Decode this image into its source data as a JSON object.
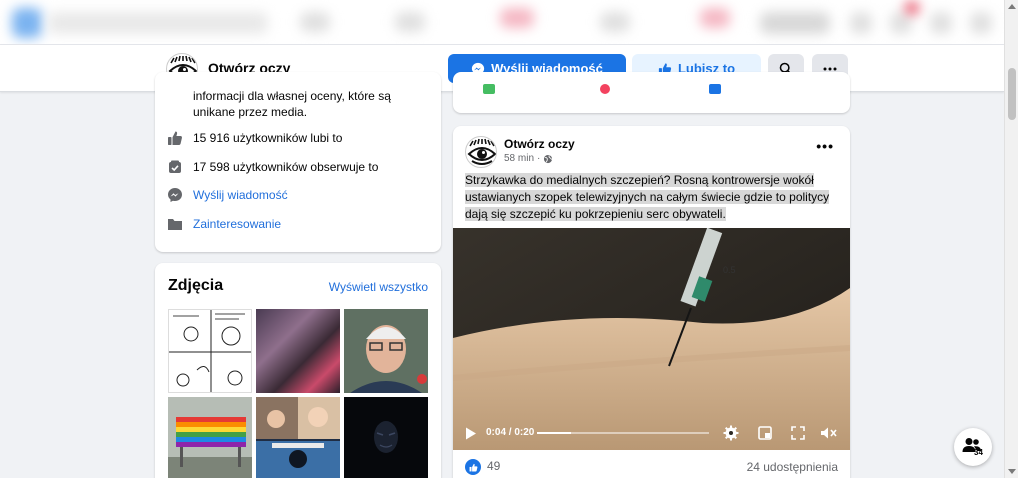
{
  "page_header": {
    "name": "Otwórz oczy",
    "message_button": "Wyślij wiadomość",
    "like_button": "Lubisz to"
  },
  "intro": {
    "text_line1": "informacji dla własnej oceny, które są",
    "text_line2": "unikane przez media.",
    "likes": "15 916 użytkowników lubi to",
    "followers": "17 598 użytkowników obserwuje to",
    "message_link": "Wyślij wiadomość",
    "category": "Zainteresowanie"
  },
  "photos": {
    "title": "Zdjęcia",
    "see_all": "Wyświetl wszystko"
  },
  "post": {
    "author": "Otwórz oczy",
    "time": "58 min",
    "text": "Strzykawka do medialnych szczepień? Rosną kontrowersje wokół ustawianych szopek telewizyjnych na całym świecie gdzie to politycy dają się szczepić ku pokrzepieniu serc obywateli.",
    "video_time": "0:04 / 0:20",
    "video_progress": 0.2,
    "reactions": "49",
    "shares": "24 udostępnienia"
  },
  "people_fab": {
    "count": "34"
  },
  "colors": {
    "brand_blue": "#1b74e4",
    "link_blue": "#216fdb",
    "light_blue": "#e7f3ff"
  }
}
